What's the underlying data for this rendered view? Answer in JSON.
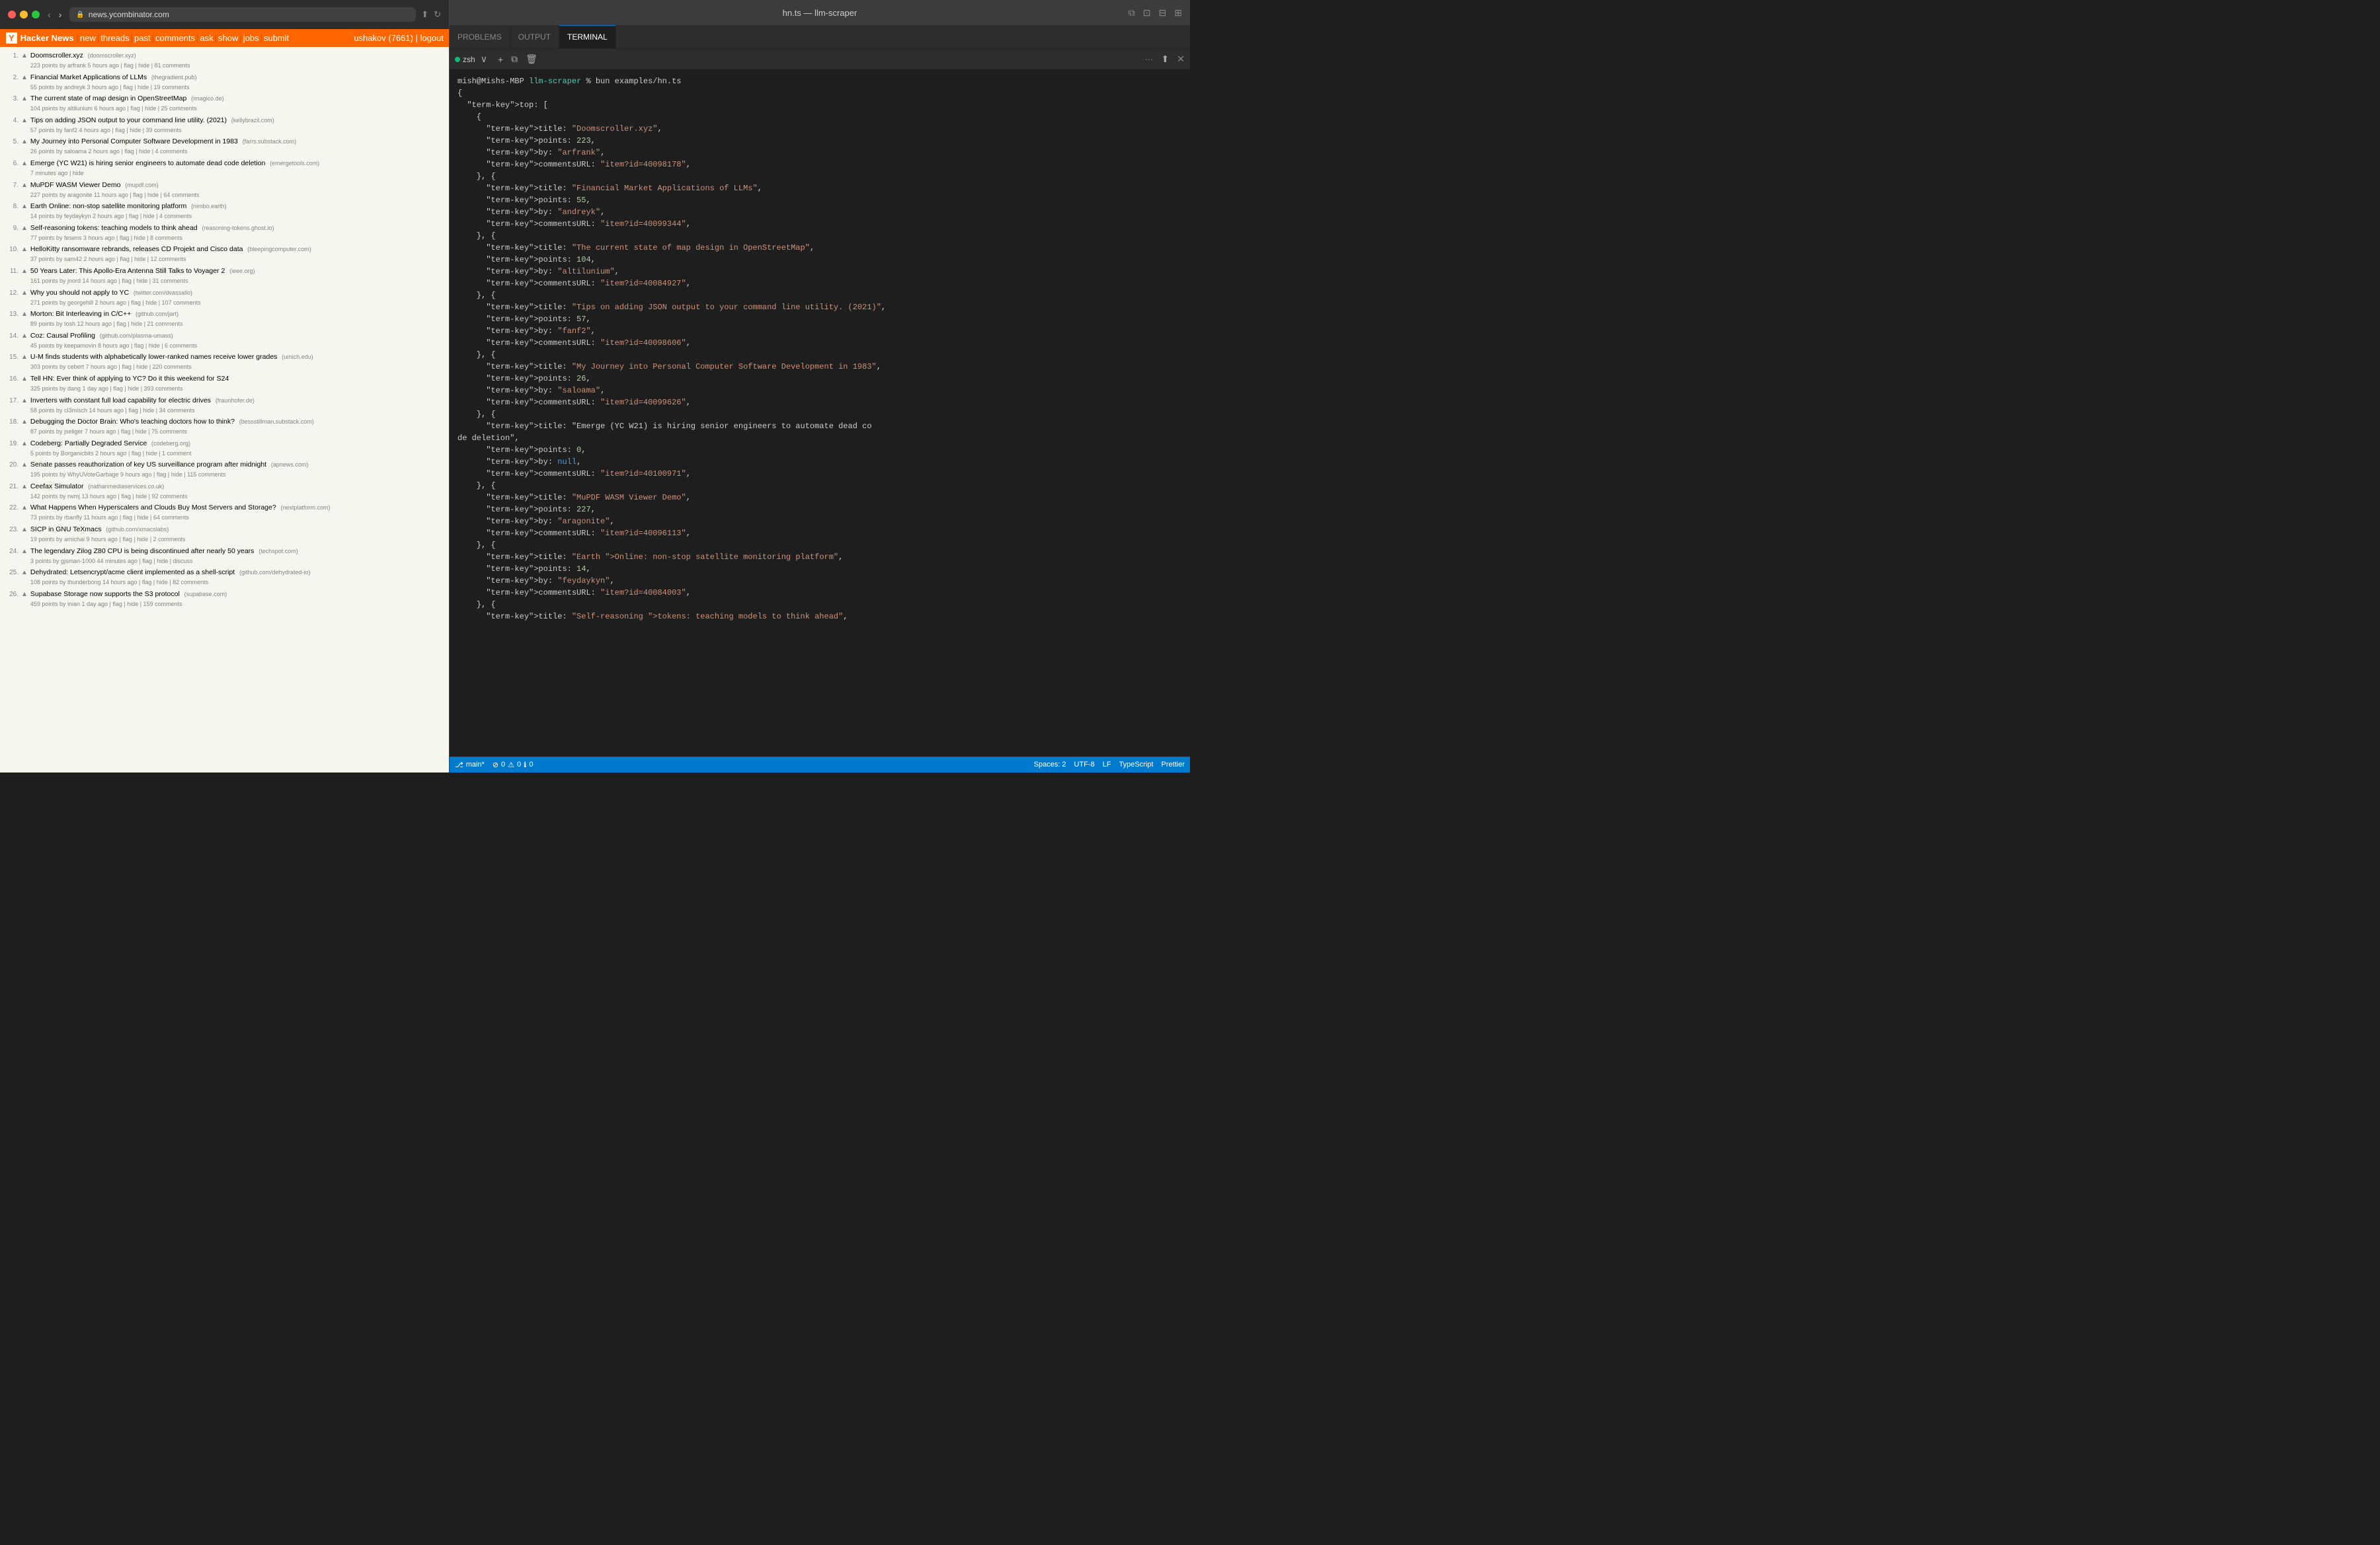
{
  "browser": {
    "url": "news.ycombinator.com",
    "hn": {
      "logo": "Y",
      "brand": "Hacker News",
      "nav_items": [
        "new",
        "threads",
        "past",
        "comments",
        "ask",
        "show",
        "jobs",
        "submit"
      ],
      "user": "ushakov (7661)",
      "logout": "logout",
      "items": [
        {
          "num": "1.",
          "title": "Doomscroller.xyz",
          "domain": "(doomscroller.xyz)",
          "points": "223 points by arfrank 5 hours ago",
          "actions": "flag | hide | 81 comments"
        },
        {
          "num": "2.",
          "title": "Financial Market Applications of LLMs",
          "domain": "(thegradient.pub)",
          "points": "55 points by andreyk 3 hours ago",
          "actions": "flag | hide | 19 comments"
        },
        {
          "num": "3.",
          "title": "The current state of map design in OpenStreetMap",
          "domain": "(imagico.de)",
          "points": "104 points by altilunium 6 hours ago",
          "actions": "flag | hide | 25 comments"
        },
        {
          "num": "4.",
          "title": "Tips on adding JSON output to your command line utility. (2021)",
          "domain": "(kellybrazil.com)",
          "points": "57 points by fanf2 4 hours ago",
          "actions": "flag | hide | 39 comments"
        },
        {
          "num": "5.",
          "title": "My Journey into Personal Computer Software Development in 1983",
          "domain": "(farrs.substack.com)",
          "points": "26 points by saloama 2 hours ago",
          "actions": "flag | hide | 4 comments"
        },
        {
          "num": "6.",
          "title": "Emerge (YC W21) is hiring senior engineers to automate dead code deletion",
          "domain": "(emergetools.com)",
          "points": "7 minutes ago",
          "actions": "hide"
        },
        {
          "num": "7.",
          "title": "MuPDF WASM Viewer Demo",
          "domain": "(mupdf.com)",
          "points": "227 points by aragonite 11 hours ago",
          "actions": "flag | hide | 64 comments"
        },
        {
          "num": "8.",
          "title": "Earth Online: non-stop satellite monitoring platform",
          "domain": "(nimbo.earth)",
          "points": "14 points by feydaykyn 2 hours ago",
          "actions": "flag | hide | 4 comments"
        },
        {
          "num": "9.",
          "title": "Self-reasoning tokens: teaching models to think ahead",
          "domain": "(reasoning-tokens.ghost.io)",
          "points": "77 points by fesens 3 hours ago",
          "actions": "flag | hide | 8 comments"
        },
        {
          "num": "10.",
          "title": "HelloKitty ransomware rebrands, releases CD Projekt and Cisco data",
          "domain": "(bleepingcomputer.com)",
          "points": "37 points by sam42 2 hours ago",
          "actions": "flag | hide | 12 comments"
        },
        {
          "num": "11.",
          "title": "50 Years Later: This Apollo-Era Antenna Still Talks to Voyager 2",
          "domain": "(ieee.org)",
          "points": "161 points by jnord 14 hours ago",
          "actions": "flag | hide | 31 comments"
        },
        {
          "num": "12.",
          "title": "Why you should not apply to YC",
          "domain": "(twitter.com/dvassallo)",
          "points": "271 points by georgehill 2 hours ago",
          "actions": "flag | hide | 107 comments"
        },
        {
          "num": "13.",
          "title": "Morton: Bit Interleaving in C/C++",
          "domain": "(github.com/jart)",
          "points": "89 points by tosh 12 hours ago",
          "actions": "flag | hide | 21 comments"
        },
        {
          "num": "14.",
          "title": "Coz: Causal Profiling",
          "domain": "(github.com/plasma-umass)",
          "points": "45 points by keepamovin 8 hours ago",
          "actions": "flag | hide | 6 comments"
        },
        {
          "num": "15.",
          "title": "U-M finds students with alphabetically lower-ranked names receive lower grades",
          "domain": "(umich.edu)",
          "points": "303 points by cebert 7 hours ago",
          "actions": "flag | hide | 220 comments"
        },
        {
          "num": "16.",
          "title": "Tell HN: Ever think of applying to YC? Do it this weekend for S24",
          "domain": "",
          "points": "325 points by dang 1 day ago",
          "actions": "flag | hide | 393 comments"
        },
        {
          "num": "17.",
          "title": "Inverters with constant full load capability for electric drives",
          "domain": "(fraunhofer.de)",
          "points": "58 points by cl3misch 14 hours ago",
          "actions": "flag | hide | 34 comments"
        },
        {
          "num": "18.",
          "title": "Debugging the Doctor Brain: Who's teaching doctors how to think?",
          "domain": "(bessstillman.substack.com)",
          "points": "87 points by jseliger 7 hours ago",
          "actions": "flag | hide | 75 comments"
        },
        {
          "num": "19.",
          "title": "Codeberg: Partially Degraded Service",
          "domain": "(codeberg.org)",
          "points": "5 points by Borganicbits 2 hours ago",
          "actions": "flag | hide | 1 comment"
        },
        {
          "num": "20.",
          "title": "Senate passes reauthorization of key US surveillance program after midnight",
          "domain": "(apnews.com)",
          "points": "195 points by WhyUVoteGarbage 9 hours ago",
          "actions": "flag | hide | 115 comments"
        },
        {
          "num": "21.",
          "title": "Ceefax Simulator",
          "domain": "(nathanmediaservices.co.uk)",
          "points": "142 points by rwmj 13 hours ago",
          "actions": "flag | hide | 92 comments"
        },
        {
          "num": "22.",
          "title": "What Happens When Hyperscalers and Clouds Buy Most Servers and Storage?",
          "domain": "(nextplatform.com)",
          "points": "73 points by rbanfly 11 hours ago",
          "actions": "flag | hide | 64 comments"
        },
        {
          "num": "23.",
          "title": "SICP in GNU TeXmacs",
          "domain": "(github.com/xmacslabs)",
          "points": "19 points by amichai 9 hours ago",
          "actions": "flag | hide | 2 comments"
        },
        {
          "num": "24.",
          "title": "The legendary Zilog Z80 CPU is being discontinued after nearly 50 years",
          "domain": "(techspot.com)",
          "points": "3 points by gjsman-1000 44 minutes ago",
          "actions": "flag | hide | discuss"
        },
        {
          "num": "25.",
          "title": "Dehydrated: Letsencrypt/acme client implemented as a shell-script",
          "domain": "(github.com/dehydrated-io)",
          "points": "108 points by thunderbong 14 hours ago",
          "actions": "flag | hide | 82 comments"
        },
        {
          "num": "26.",
          "title": "Supabase Storage now supports the S3 protocol",
          "domain": "(supabase.com)",
          "points": "459 points by inian 1 day ago",
          "actions": "flag | hide | 159 comments"
        }
      ]
    }
  },
  "vscode": {
    "title": "hn.ts — llm-scraper",
    "tabs": [
      {
        "label": "PROBLEMS",
        "active": false
      },
      {
        "label": "OUTPUT",
        "active": false
      },
      {
        "label": "TERMINAL",
        "active": true
      }
    ],
    "toolbar": {
      "terminal_label": "zsh",
      "add_label": "+",
      "more_label": "···",
      "close_label": "✕"
    },
    "terminal": {
      "prompt_user": "mish@Mishs-MBP",
      "prompt_path": "llm-scraper",
      "command": "% bun examples/hn.ts",
      "output_lines": [
        "{",
        "  top: [",
        "    {",
        "      title: \"Doomscroller.xyz\",",
        "      points: 223,",
        "      by: \"arfrank\",",
        "      commentsURL: \"item?id=40098178\",",
        "    }, {",
        "      title: \"Financial Market Applications of LLMs\",",
        "      points: 55,",
        "      by: \"andreyk\",",
        "      commentsURL: \"item?id=40099344\",",
        "    }, {",
        "      title: \"The current state of map design in OpenStreetMap\",",
        "      points: 104,",
        "      by: \"altilunium\",",
        "      commentsURL: \"item?id=40084927\",",
        "    }, {",
        "      title: \"Tips on adding JSON output to your command line utility. (2021)\",",
        "      points: 57,",
        "      by: \"fanf2\",",
        "      commentsURL: \"item?id=40098606\",",
        "    }, {",
        "      title: \"My Journey into Personal Computer Software Development in 1983\",",
        "      points: 26,",
        "      by: \"saloama\",",
        "      commentsURL: \"item?id=40099626\",",
        "    }, {",
        "      title: \"Emerge (YC W21) is hiring senior engineers to automate dead co",
        "de deletion\",",
        "      points: 0,",
        "      by: null,",
        "      commentsURL: \"item?id=40100971\",",
        "    }, {",
        "      title: \"MuPDF WASM Viewer Demo\",",
        "      points: 227,",
        "      by: \"aragonite\",",
        "      commentsURL: \"item?id=40096113\",",
        "    }, {",
        "      title: \"Earth Online: non-stop satellite monitoring platform\",",
        "      points: 14,",
        "      by: \"feydaykyn\",",
        "      commentsURL: \"item?id=40084003\",",
        "    }, {",
        "      title: \"Self-reasoning tokens: teaching models to think ahead\","
      ]
    },
    "statusbar": {
      "branch": "main*",
      "errors": "0",
      "warnings": "0",
      "info": "0",
      "spaces": "Spaces: 2",
      "encoding": "UTF-8",
      "line_ending": "LF",
      "language": "TypeScript",
      "formatter": "Prettier"
    }
  }
}
